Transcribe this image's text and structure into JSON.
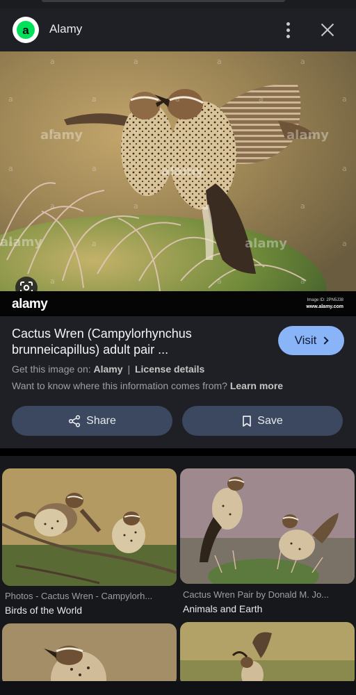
{
  "header": {
    "site_name": "Alamy",
    "logo_letter": "a"
  },
  "hero": {
    "watermark": "alamy",
    "brand_mark": "alamy",
    "image_id": "Image ID: 2PN5J38",
    "url": "www.alamy.com"
  },
  "info": {
    "title": "Cactus Wren (Campylorhynchus brunneicapillus) adult pair ...",
    "visit_label": "Visit",
    "source_prefix": "Get this image on:",
    "source_name": "Alamy",
    "separator": "|",
    "license_label": "License details",
    "learn_prefix": "Want to know where this information comes from?",
    "learn_more_label": "Learn more",
    "share_label": "Share",
    "save_label": "Save"
  },
  "related": [
    {
      "source": "Photos - Cactus Wren - Campylorh...",
      "title": "Birds of the World"
    },
    {
      "source": "Cactus Wren Pair by Donald M. Jo...",
      "title": "Animals and Earth"
    }
  ],
  "colors": {
    "accent": "#8ab4f8",
    "button_bg": "#3b4860",
    "card_bg": "#1f2026",
    "logo_green": "#00e05a"
  }
}
